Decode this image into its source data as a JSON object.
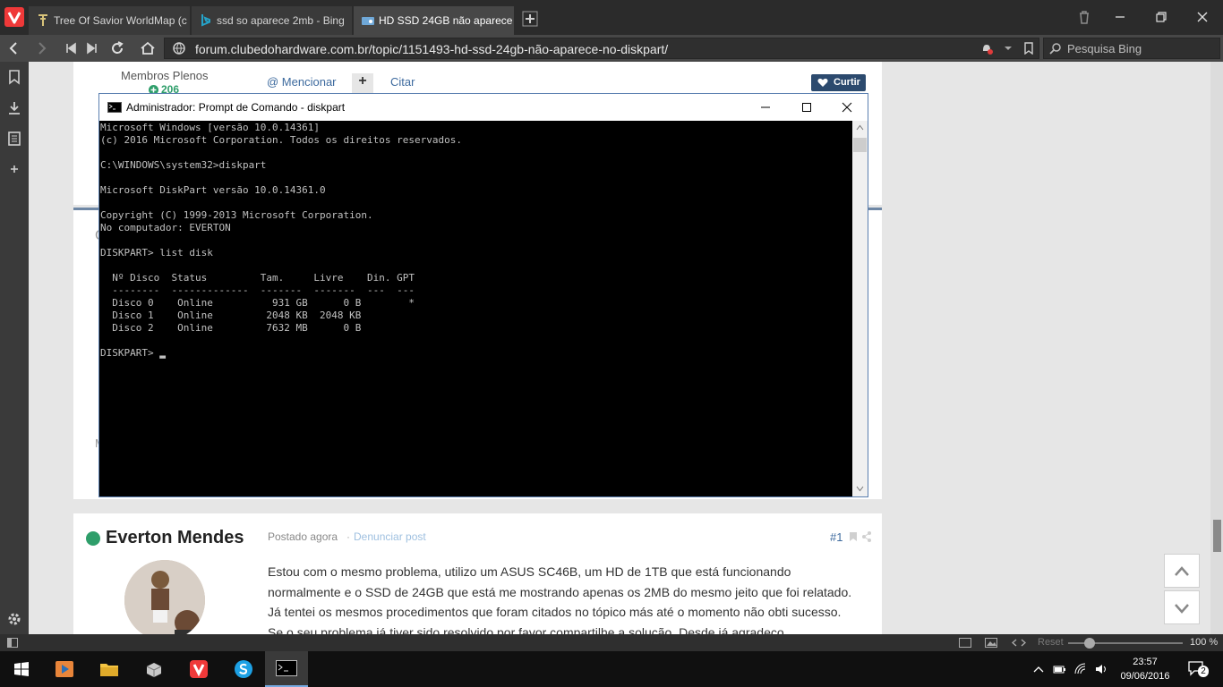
{
  "browser": {
    "tabs": [
      {
        "title": "Tree Of Savior WorldMap (c",
        "active": false
      },
      {
        "title": "ssd so aparece 2mb - Bing",
        "active": false
      },
      {
        "title": "HD SSD 24GB não aparece n",
        "active": true
      }
    ],
    "url": "forum.clubedohardware.com.br/topic/1151493-hd-ssd-24gb-não-aparece-no-diskpart/",
    "search_placeholder": "Pesquisa Bing",
    "status": {
      "reset_label": "Reset",
      "zoom": "100 %"
    }
  },
  "forum": {
    "prev_post": {
      "member_group": "Membros Plenos",
      "reputation": "206",
      "mention_label": "@ Mencionar",
      "quote_plus": "+",
      "quote_label": "Citar",
      "like_label": "Curtir"
    },
    "hidden_letters": {
      "left_c": "C",
      "left_m": "M"
    },
    "post": {
      "author": "Everton Mendes",
      "online_color": "#2e9e6a",
      "posted": "Postado agora",
      "separator": "·",
      "report": "Denunciar post",
      "post_number": "#1",
      "body_lines": [
        "Estou com o mesmo problema, utilizo um ASUS SC46B, um HD de 1TB que está funcionando",
        "normalmente e o SSD de 24GB que está me mostrando apenas os 2MB do mesmo jeito que foi relatado.",
        "Já tentei os mesmos procedimentos que foram citados no tópico más até o momento não obti sucesso.",
        "Se o seu problema já tiver sido resolvido por favor compartilhe a solução. Desde já agradeço."
      ]
    }
  },
  "cmd": {
    "title": "Administrador: Prompt de Comando - diskpart",
    "output": "Microsoft Windows [versão 10.0.14361]\n(c) 2016 Microsoft Corporation. Todos os direitos reservados.\n\nC:\\WINDOWS\\system32>diskpart\n\nMicrosoft DiskPart versão 10.0.14361.0\n\nCopyright (C) 1999-2013 Microsoft Corporation.\nNo computador: EVERTON\n\nDISKPART> list disk\n\n  Nº Disco  Status         Tam.     Livre    Din. GPT\n  --------  -------------  -------  -------  ---  ---\n  Disco 0    Online          931 GB      0 B        *\n  Disco 1    Online         2048 KB  2048 KB\n  Disco 2    Online         7632 MB      0 B\n\nDISKPART> ▂"
  },
  "taskbar": {
    "time": "23:57",
    "date": "09/06/2016",
    "notifications": "2"
  },
  "colors": {
    "vivaldi_red": "#ef3939",
    "link_blue": "#3d6a9e",
    "cmd_text": "#c0c0c0"
  }
}
